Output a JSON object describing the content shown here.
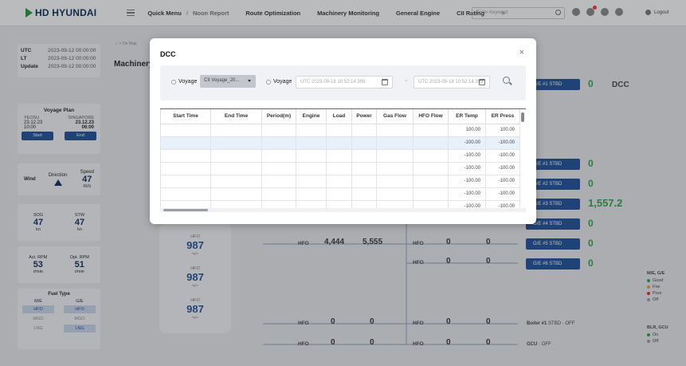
{
  "header": {
    "brand": "HD HYUNDAI",
    "nav": [
      {
        "label": "Quick Menu",
        "bold": true
      },
      {
        "label": "Route Optimization",
        "bold": true
      },
      {
        "label": "Machinery Monitoring",
        "bold": true
      },
      {
        "label": "General Engine",
        "bold": true
      },
      {
        "label": "CII Rating",
        "bold": true
      }
    ],
    "sub_item": "Noon Report",
    "more": "»",
    "search_placeholder": "Enter Keyword",
    "logout": "Logout"
  },
  "time_panel": {
    "rows": [
      {
        "label": "UTC",
        "value": "2023-09-12 00:00:00"
      },
      {
        "label": "LT",
        "value": "2023-09-12 00:00:00"
      },
      {
        "label": "Update",
        "value": "2023-09-12 00:00:00"
      }
    ]
  },
  "voyage_plan": {
    "title": "Voyage Plan",
    "from": "YEOSU",
    "to": "SINGAPORE",
    "from_date": "23.12.23",
    "from_time": "10:00",
    "to_date": "23.12.23",
    "to_time": "06:00",
    "start_label": "Start",
    "end_label": "End"
  },
  "weather": {
    "wind_label": "Wind",
    "direction_label": "Direction",
    "speed_label": "Speed",
    "speed_value": "47",
    "speed_unit": "m/s"
  },
  "sog": {
    "sog_label": "SOG",
    "sog_value": "47",
    "stw_label": "STW",
    "stw_value": "47",
    "unit": "kn"
  },
  "rpm": {
    "act_label": "Act. RPM",
    "act_value": "53",
    "opt_label": "Opt. RPM",
    "opt_value": "51",
    "unit": "r/min"
  },
  "fuel_type": {
    "title": "Fuel Type",
    "me_label": "M/E",
    "ge_label": "G/E",
    "me_items": [
      "HFO",
      "MGO",
      "LNG"
    ],
    "ge_items": [
      "HFO",
      "MGO",
      "LNG"
    ]
  },
  "page": {
    "title": "Machinery",
    "breadcrumb": "On Map"
  },
  "engine_col": {
    "cap": "HFO",
    "values": [
      "987",
      "987",
      "987"
    ],
    "unit": "kg/h"
  },
  "flows": {
    "row1": {
      "label": "HFO",
      "value1": "4,444",
      "value2": "5,555"
    },
    "row2": {
      "label": "HFO",
      "value1": "0",
      "value2": "0"
    },
    "row3": {
      "label": "HFO",
      "value1": "0",
      "value2": "0"
    },
    "right_labels": [
      "HFO",
      "HFO",
      "HFO",
      "HFO"
    ],
    "right_values": [
      "0",
      "0",
      "0",
      "0"
    ]
  },
  "generators": [
    {
      "label": "G/E #1 STBD",
      "value": "0"
    },
    {
      "label": "G/E #1 STBD",
      "value": "0"
    },
    {
      "label": "G/E #2 STBD",
      "value": "0"
    },
    {
      "label": "G/E #3 STBD",
      "value": "1,557.2"
    },
    {
      "label": "G/E #4 STBD",
      "value": "0"
    },
    {
      "label": "G/E #5 STBD",
      "value": "0"
    },
    {
      "label": "G/E #6 STBD",
      "value": "0"
    }
  ],
  "dcc_side_label": "DCC",
  "boiler": {
    "label": "Boiler #1",
    "side": "STBD",
    "state": "OFF"
  },
  "gcu": {
    "label": "GCU",
    "state": "OFF"
  },
  "legend_me": {
    "title": "M/E, G/E",
    "items": [
      {
        "label": "Good",
        "color": "#2ca44a"
      },
      {
        "label": "Fire",
        "color": "#f0a020"
      },
      {
        "label": "Poor",
        "color": "#d93025"
      },
      {
        "label": "Off",
        "color": "#9aa0a6"
      }
    ]
  },
  "legend_blr": {
    "title": "BLR, GCU",
    "items": [
      {
        "label": "On",
        "color": "#2ca44a"
      },
      {
        "label": "Off",
        "color": "#9aa0a6"
      }
    ]
  },
  "modal": {
    "title": "DCC",
    "close": "×",
    "radio1_label": "Voyage",
    "select_value": "CII Voyage_20...",
    "radio2_label": "Voyage",
    "date_from": "UTC 2023-09-18 10:52:14.359",
    "date_sep": "~",
    "date_to": "UTC 2023-09-18 10:52:14.359",
    "columns": [
      "Start Time",
      "End Time",
      "Period(m)",
      "Engine",
      "Load",
      "Power",
      "Gas Flow",
      "HFO Flow",
      "ER Temp",
      "ER Press"
    ],
    "rows": [
      [
        "",
        "",
        "",
        "",
        "",
        "",
        "",
        "",
        "100.00",
        "100.00"
      ],
      [
        "",
        "",
        "",
        "",
        "",
        "",
        "",
        "",
        "-100.00",
        "-100.00"
      ],
      [
        "",
        "",
        "",
        "",
        "",
        "",
        "",
        "",
        "-100.00",
        "-100.00"
      ],
      [
        "",
        "",
        "",
        "",
        "",
        "",
        "",
        "",
        "-100.00",
        "-100.00"
      ],
      [
        "",
        "",
        "",
        "",
        "",
        "",
        "",
        "",
        "-100.00",
        "-100.00"
      ],
      [
        "",
        "",
        "",
        "",
        "",
        "",
        "",
        "",
        "-100.00",
        "-100.00"
      ],
      [
        "",
        "",
        "",
        "",
        "",
        "",
        "",
        "",
        "-100.00",
        "-100.00"
      ]
    ],
    "selected_row": 1
  }
}
